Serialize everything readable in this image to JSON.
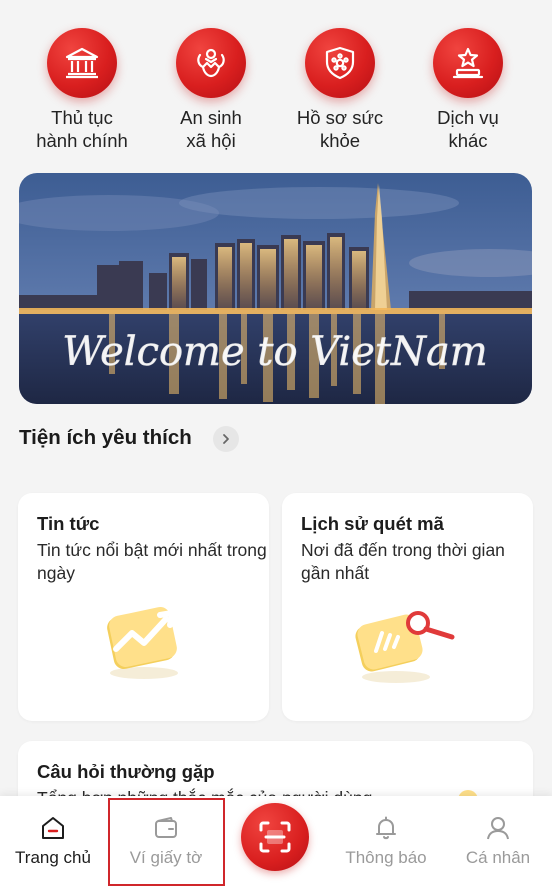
{
  "services": [
    {
      "label": "Thủ tục\nhành chính",
      "icon": "government-building-icon"
    },
    {
      "label": "An sinh\nxã hội",
      "icon": "social-welfare-icon"
    },
    {
      "label": "Hồ sơ sức\nkhỏe",
      "icon": "health-shield-icon"
    },
    {
      "label": "Dịch vụ\nkhác",
      "icon": "star-podium-icon"
    }
  ],
  "banner": {
    "caption": "Welcome to VietNam"
  },
  "favorites": {
    "title": "Tiện ích yêu thích"
  },
  "cards": [
    {
      "title": "Tin tức",
      "description": "Tin tức nổi bật mới nhất trong ngày",
      "icon": "trending-news-icon"
    },
    {
      "title": "Lịch sử quét mã",
      "description": "Nơi đã đến trong thời gian gần nhất",
      "icon": "scan-history-icon"
    },
    {
      "title": "Câu hỏi thường gặp",
      "description": "Tổng hợp những thắc mắc của người dùng",
      "icon": "faq-icon"
    }
  ],
  "nav": {
    "home": "Trang chủ",
    "wallet": "Ví giấy tờ",
    "notifications": "Thông báo",
    "profile": "Cá nhân"
  },
  "colors": {
    "accent": "#d91f1f",
    "highlight_frame": "#d0262b",
    "background": "#f4f4f4"
  }
}
